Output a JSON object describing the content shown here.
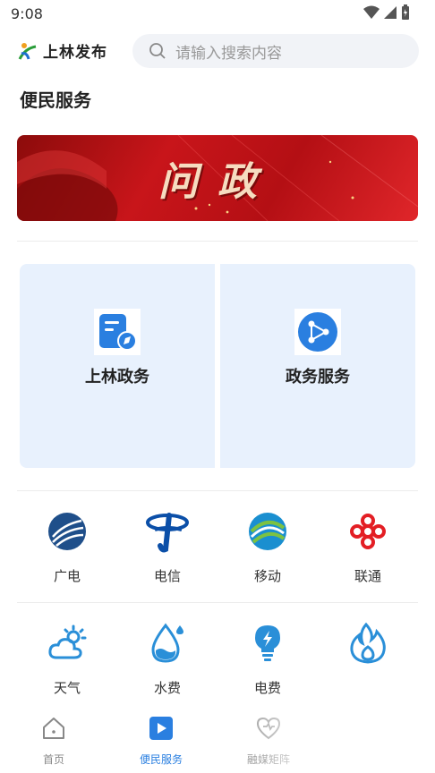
{
  "status": {
    "time": "9:08"
  },
  "header": {
    "brand": "上林发布",
    "search_placeholder": "请输入搜索内容"
  },
  "page": {
    "title": "便民服务"
  },
  "banner": {
    "text": "问政"
  },
  "cards": [
    {
      "label": "上林政务",
      "icon": "document-compass-icon"
    },
    {
      "label": "政务服务",
      "icon": "share-network-icon"
    }
  ],
  "grid_row1": [
    {
      "label": "广电",
      "icon": "broadcast-tv-icon"
    },
    {
      "label": "电信",
      "icon": "china-telecom-icon"
    },
    {
      "label": "移动",
      "icon": "china-mobile-icon"
    },
    {
      "label": "联通",
      "icon": "china-unicom-icon"
    }
  ],
  "grid_row2": [
    {
      "label": "天气",
      "icon": "weather-icon"
    },
    {
      "label": "水费",
      "icon": "water-drop-icon"
    },
    {
      "label": "电费",
      "icon": "electricity-icon"
    },
    {
      "label": "",
      "icon": "gas-flame-icon"
    }
  ],
  "tabs": [
    {
      "label": "首页",
      "icon": "home-icon",
      "active": false
    },
    {
      "label": "便民服务",
      "icon": "play-icon",
      "active": true
    },
    {
      "label": "融媒矩阵",
      "icon": "heart-icon",
      "active": false
    }
  ],
  "colors": {
    "accent": "#2a7fe0",
    "banner_red": "#c8151a",
    "card_bg": "#e8f1fd"
  }
}
